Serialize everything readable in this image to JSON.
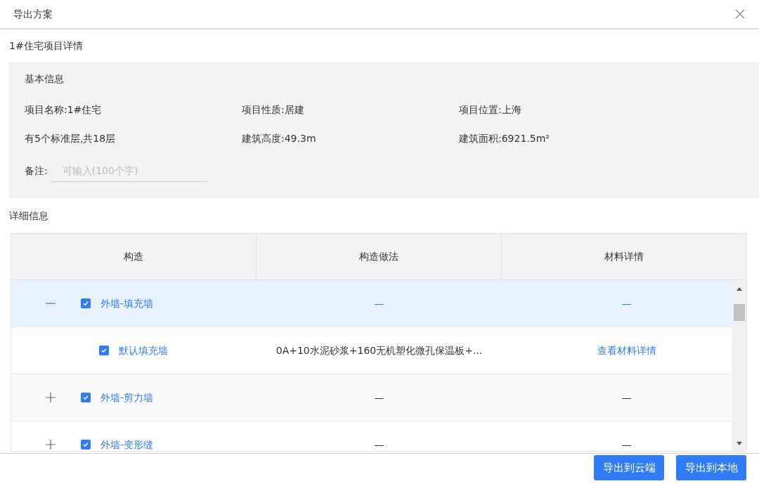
{
  "dialog": {
    "title": "导出方案"
  },
  "project_title": "1#住宅项目详情",
  "basic_info": {
    "heading": "基本信息",
    "fields": [
      "项目名称:1#住宅",
      "项目性质:居建",
      "项目位置:上海",
      "有5个标准层,共18层",
      "建筑高度:49.3m",
      "建筑面积:6921.5m²"
    ],
    "remark": {
      "label": "备注:",
      "placeholder": "可输入(100个字)"
    }
  },
  "detail": {
    "heading": "详细信息",
    "columns": [
      "构造",
      "构造做法",
      "材料详情"
    ],
    "rows": [
      {
        "kind": "group",
        "expanded": true,
        "selected": true,
        "checked": true,
        "name": "外墙-填充墙",
        "method": "—",
        "materials": "—"
      },
      {
        "kind": "item",
        "selected": false,
        "checked": true,
        "name": "默认填充墙",
        "method": "0A+10水泥砂浆+160无机塑化微孔保温板+...",
        "materials": "查看材料详情"
      },
      {
        "kind": "group",
        "expanded": false,
        "selected": false,
        "checked": true,
        "name": "外墙-剪力墙",
        "method": "—",
        "materials": "—"
      },
      {
        "kind": "group",
        "expanded": false,
        "selected": false,
        "checked": true,
        "name": "外墙-变形缝",
        "method": "—",
        "materials": "—"
      }
    ]
  },
  "buttons": [
    "导出到云端",
    "导出到本地"
  ]
}
